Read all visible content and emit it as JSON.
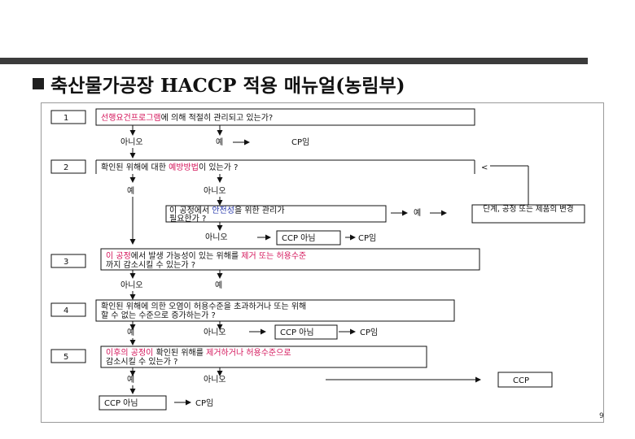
{
  "slide_title": "축산물가공장 HACCP 적용 매뉴얼(농림부)",
  "page_number": "9",
  "steps": [
    {
      "num": "1",
      "question": {
        "red": "선행요건프로그램",
        "rest": "에 의해 적절히 관리되고 있는가?"
      },
      "no": "아니오",
      "yes": "예",
      "result": "CP임"
    },
    {
      "num": "2",
      "question": {
        "pre": "확인된 위해에 대한 ",
        "red": "예방방법",
        "post": "이 있는가 ?"
      },
      "yes": "예",
      "no": "아니오",
      "sub_question": {
        "pre": "이 공정에서 ",
        "red": "안전성",
        "post": "을 위한 관리가",
        "line2": "필요한가 ?"
      },
      "sub_yes": "예",
      "modify": "단계, 공정 또는 제품의 변경",
      "sub_no": "아니오",
      "ccp_no": "CCP 아님",
      "result": "CP임"
    },
    {
      "num": "3",
      "question": {
        "red": "이 공정",
        "mid": "에서 발생 가능성이 있는 위해를 ",
        "red2": "제거 또는 허용수준",
        "line2": "까지 감소시킬 수 있는가 ?"
      },
      "no": "아니오",
      "yes": "예"
    },
    {
      "num": "4",
      "question": {
        "line1": "확인된 위해에 의한 오염이 허용수준을 초과하거나 또는 위해",
        "line2": "할 수 없는 수준으로 증가하는가 ?"
      },
      "yes": "예",
      "no": "아니오",
      "ccp_no": "CCP 아님",
      "result": "CP임"
    },
    {
      "num": "5",
      "question": {
        "red": "이후의 공정이",
        "mid": " 확인된 위해를 ",
        "red2": "제거하거나 허용수준으로",
        "line2": "감소시킬 수 있는가 ?"
      },
      "yes": "예",
      "no": "아니오",
      "ccp_no": "CCP 아님",
      "result": "CP임",
      "ccp": "CCP"
    }
  ]
}
